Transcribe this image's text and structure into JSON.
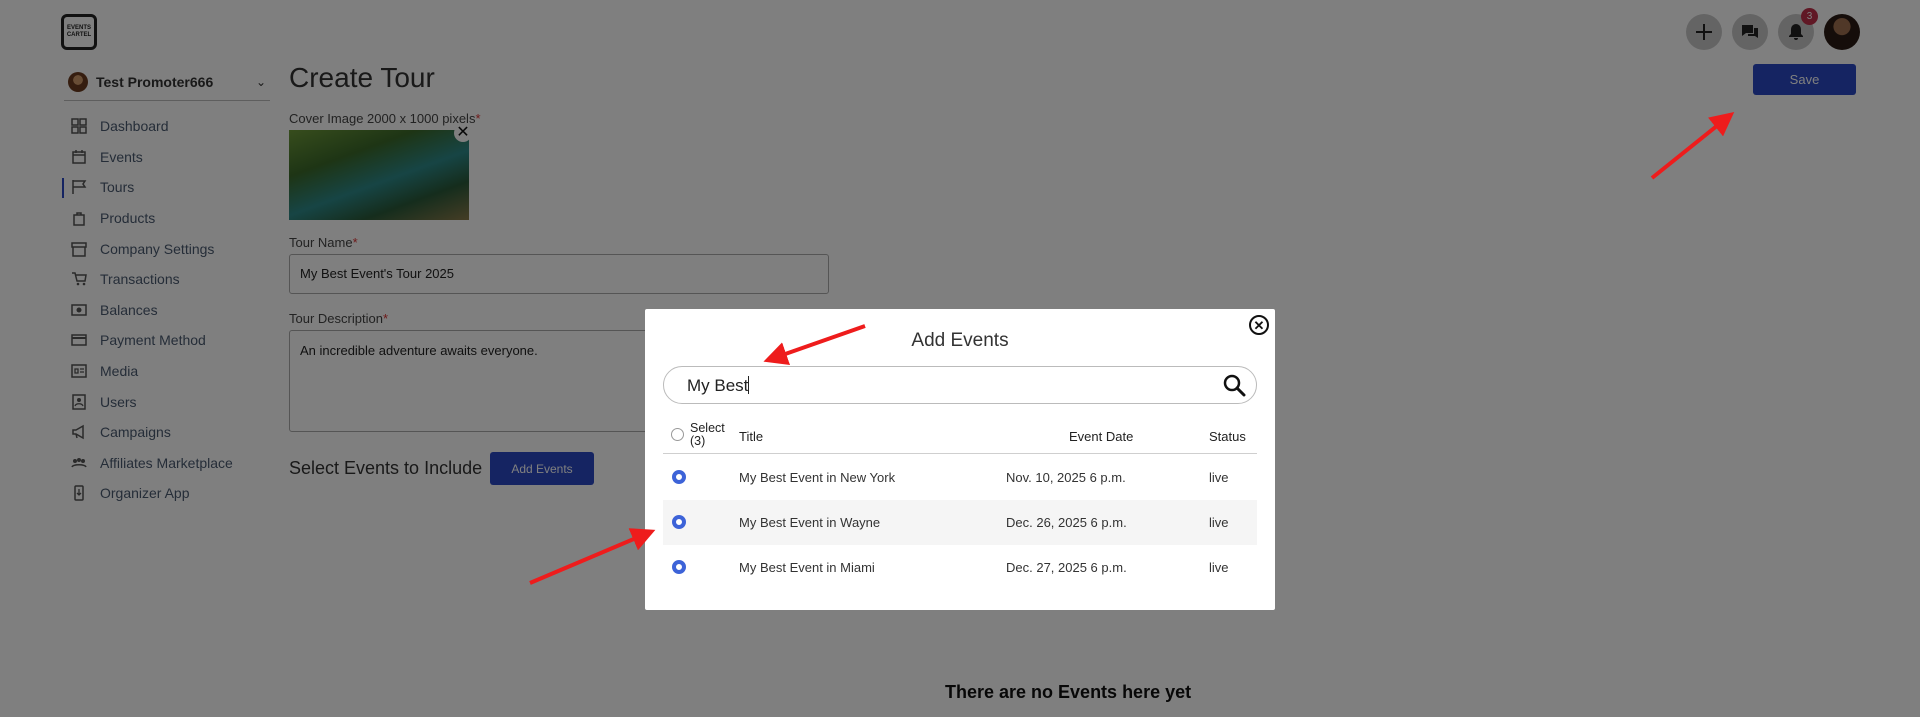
{
  "app": {
    "logo_text": "EVENTS CARTEL"
  },
  "header": {
    "notification_count": "3",
    "save_label": "Save"
  },
  "sidebar": {
    "account_name": "Test Promoter666",
    "items": [
      {
        "label": "Dashboard",
        "icon": "dashboard-icon"
      },
      {
        "label": "Events",
        "icon": "calendar-icon"
      },
      {
        "label": "Tours",
        "icon": "flag-icon",
        "active": true
      },
      {
        "label": "Products",
        "icon": "bag-icon"
      },
      {
        "label": "Company Settings",
        "icon": "store-icon"
      },
      {
        "label": "Transactions",
        "icon": "cart-icon"
      },
      {
        "label": "Balances",
        "icon": "balance-icon"
      },
      {
        "label": "Payment Method",
        "icon": "card-icon"
      },
      {
        "label": "Media",
        "icon": "media-icon"
      },
      {
        "label": "Users",
        "icon": "users-icon"
      },
      {
        "label": "Campaigns",
        "icon": "megaphone-icon"
      },
      {
        "label": "Affiliates Marketplace",
        "icon": "people-icon"
      },
      {
        "label": "Organizer App",
        "icon": "phone-icon"
      }
    ]
  },
  "main": {
    "title": "Create Tour",
    "cover_label": "Cover Image 2000 x 1000 pixels",
    "tour_name_label": "Tour Name",
    "tour_name_value": "My Best Event's Tour 2025",
    "description_label": "Tour Description",
    "description_value": "An incredible adventure awaits everyone.",
    "select_events_label": "Select Events to Include",
    "add_events_label": "Add Events",
    "empty_message": "There are no Events here yet"
  },
  "modal": {
    "title": "Add Events",
    "search_value": "My Best",
    "columns": {
      "select": "Select (3)",
      "title": "Title",
      "date": "Event Date",
      "status": "Status"
    },
    "rows": [
      {
        "title": "My Best Event in New York",
        "date": "Nov. 10, 2025 6 p.m.",
        "status": "live"
      },
      {
        "title": "My Best Event in Wayne",
        "date": "Dec. 26, 2025 6 p.m.",
        "status": "live"
      },
      {
        "title": "My Best Event in Miami",
        "date": "Dec. 27, 2025 6 p.m.",
        "status": "live"
      }
    ]
  },
  "colors": {
    "primary": "#2a49c4",
    "radio": "#3d63d8",
    "annotation": "#ee1c1c",
    "badge": "#c0304a"
  }
}
